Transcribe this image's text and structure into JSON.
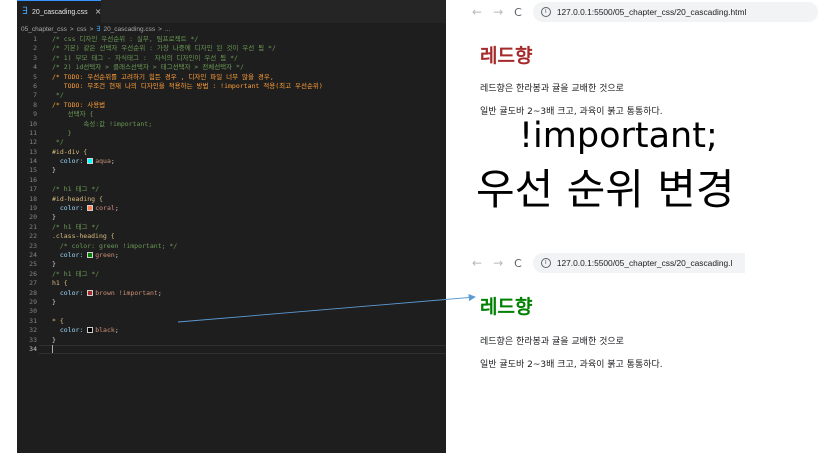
{
  "editor": {
    "tab_label": "20_cascading.css",
    "tab_close": "×",
    "css_icon": "∃",
    "breadcrumb": [
      "05_chapter_css",
      ">",
      "css",
      ">",
      "∃",
      "20_cascading.css",
      ">",
      "..."
    ],
    "lines": [
      {
        "n": "1",
        "segments": [
          {
            "t": "/* css 디자인 우선순위 : 실무, 팀프로젝트 */",
            "c": "#6a9955"
          }
        ]
      },
      {
        "n": "2",
        "segments": [
          {
            "t": "/* 기본) 같은 선택자 우선순위 : 가장 나중에 디자인 된 것이 우선 됨 */",
            "c": "#6a9955"
          }
        ]
      },
      {
        "n": "3",
        "segments": [
          {
            "t": "/* 1) 부모 태그 - 자식태그 :  자식의 디자인이 우선 됨 */",
            "c": "#6a9955"
          }
        ]
      },
      {
        "n": "4",
        "segments": [
          {
            "t": "/* 2) id선택자 > 클래스선택자 > 태그선택자 > 전체선택자 */",
            "c": "#6a9955"
          }
        ]
      },
      {
        "n": "5",
        "segments": [
          {
            "t": "/* TODO: 우선순위를 고려하기 힘든 경우 , 디자인 파일 너무 많을 경우,",
            "c": "#ff9e3b"
          }
        ]
      },
      {
        "n": "6",
        "segments": [
          {
            "t": "   TODO: 무조건 현재 나의 디자인을 적용하는 방법 : !important 적용(최고 우선순위)",
            "c": "#ff9e3b"
          }
        ]
      },
      {
        "n": "7",
        "segments": [
          {
            "t": " */",
            "c": "#6a9955"
          }
        ]
      },
      {
        "n": "8",
        "segments": [
          {
            "t": "/* TODO: 사용법",
            "c": "#ff9e3b"
          }
        ]
      },
      {
        "n": "9",
        "segments": [
          {
            "t": "    선택자 {",
            "c": "#6a9955"
          }
        ]
      },
      {
        "n": "10",
        "segments": [
          {
            "t": "        속성:값 !important;",
            "c": "#6a9955"
          }
        ]
      },
      {
        "n": "11",
        "segments": [
          {
            "t": "    }",
            "c": "#6a9955"
          }
        ]
      },
      {
        "n": "12",
        "segments": [
          {
            "t": " */",
            "c": "#6a9955"
          }
        ]
      },
      {
        "n": "13",
        "segments": [
          {
            "t": "#id-div {",
            "c": "#d7ba7d"
          }
        ]
      },
      {
        "n": "14",
        "segments": [
          {
            "t": "  color: ",
            "c": "#9cdcfe"
          },
          {
            "swatch": "#00ffff"
          },
          {
            "t": "aqua",
            "c": "#ce9178"
          },
          {
            "t": ";",
            "c": "#d4d4d4"
          }
        ]
      },
      {
        "n": "15",
        "segments": [
          {
            "t": "}",
            "c": "#d4d4d4"
          }
        ]
      },
      {
        "n": "16",
        "segments": []
      },
      {
        "n": "17",
        "segments": [
          {
            "t": "/* h1 태그 */",
            "c": "#6a9955"
          }
        ]
      },
      {
        "n": "18",
        "segments": [
          {
            "t": "#id-heading {",
            "c": "#d7ba7d"
          }
        ]
      },
      {
        "n": "19",
        "segments": [
          {
            "t": "  color: ",
            "c": "#9cdcfe"
          },
          {
            "swatch": "#ff7f50"
          },
          {
            "t": "coral",
            "c": "#ce9178"
          },
          {
            "t": ";",
            "c": "#d4d4d4"
          }
        ]
      },
      {
        "n": "20",
        "segments": [
          {
            "t": "}",
            "c": "#d4d4d4"
          }
        ]
      },
      {
        "n": "21",
        "segments": [
          {
            "t": "/* h1 태그 */",
            "c": "#6a9955"
          }
        ]
      },
      {
        "n": "22",
        "segments": [
          {
            "t": ".class-heading {",
            "c": "#d7ba7d"
          }
        ]
      },
      {
        "n": "23",
        "segments": [
          {
            "t": "  /* color: green !important; */",
            "c": "#6a9955"
          }
        ]
      },
      {
        "n": "24",
        "segments": [
          {
            "t": "  color: ",
            "c": "#9cdcfe"
          },
          {
            "swatch": "#008000"
          },
          {
            "t": "green",
            "c": "#ce9178"
          },
          {
            "t": ";",
            "c": "#d4d4d4"
          }
        ]
      },
      {
        "n": "25",
        "segments": [
          {
            "t": "}",
            "c": "#d4d4d4"
          }
        ]
      },
      {
        "n": "26",
        "segments": [
          {
            "t": "/* h1 태그 */",
            "c": "#6a9955"
          }
        ]
      },
      {
        "n": "27",
        "segments": [
          {
            "t": "h1 {",
            "c": "#d7ba7d"
          }
        ]
      },
      {
        "n": "28",
        "segments": [
          {
            "t": "  color: ",
            "c": "#9cdcfe"
          },
          {
            "swatch": "#a52a2a"
          },
          {
            "t": "brown !important",
            "c": "#ce9178"
          },
          {
            "t": ";",
            "c": "#d4d4d4"
          }
        ]
      },
      {
        "n": "29",
        "segments": [
          {
            "t": "}",
            "c": "#d4d4d4"
          }
        ]
      },
      {
        "n": "30",
        "segments": []
      },
      {
        "n": "31",
        "segments": [
          {
            "t": "* {",
            "c": "#d7ba7d"
          }
        ]
      },
      {
        "n": "32",
        "segments": [
          {
            "t": "  color: ",
            "c": "#9cdcfe"
          },
          {
            "swatch": "#000000"
          },
          {
            "t": "black",
            "c": "#ce9178"
          },
          {
            "t": ";",
            "c": "#d4d4d4"
          }
        ]
      },
      {
        "n": "33",
        "segments": [
          {
            "t": "}",
            "c": "#d4d4d4"
          }
        ]
      },
      {
        "n": "34",
        "segments": [],
        "current": true
      }
    ]
  },
  "browser_top": {
    "back_icon": "←",
    "forward_icon": "→",
    "reload_icon": "C",
    "info_icon": "i",
    "url": "127.0.0.1:5500/05_chapter_css/20_cascading.html",
    "heading": "레드향",
    "heading_color": "#a52a2a",
    "para1": "레드향은 한라봉과 귤을 교배한 것으로",
    "para2": "일반 귤도바 2~3배 크고, 과육이 붉고 통통하다."
  },
  "annotation": {
    "line1": "!important;",
    "line2": "우선 순위 변경"
  },
  "browser_bottom": {
    "back_icon": "←",
    "forward_icon": "→",
    "reload_icon": "C",
    "info_icon": "i",
    "url": "127.0.0.1:5500/05_chapter_css/20_cascading.l",
    "heading": "레드향",
    "heading_color": "#008000",
    "para1": "레드향은 한라봉과 귤을 교배한 것으로",
    "para2": "일반 귤도바 2~3배 크고, 과육이 붉고 통통하다."
  },
  "colors": {
    "editor_bg": "#1e1e1e",
    "arrow": "#5b9bd5"
  }
}
